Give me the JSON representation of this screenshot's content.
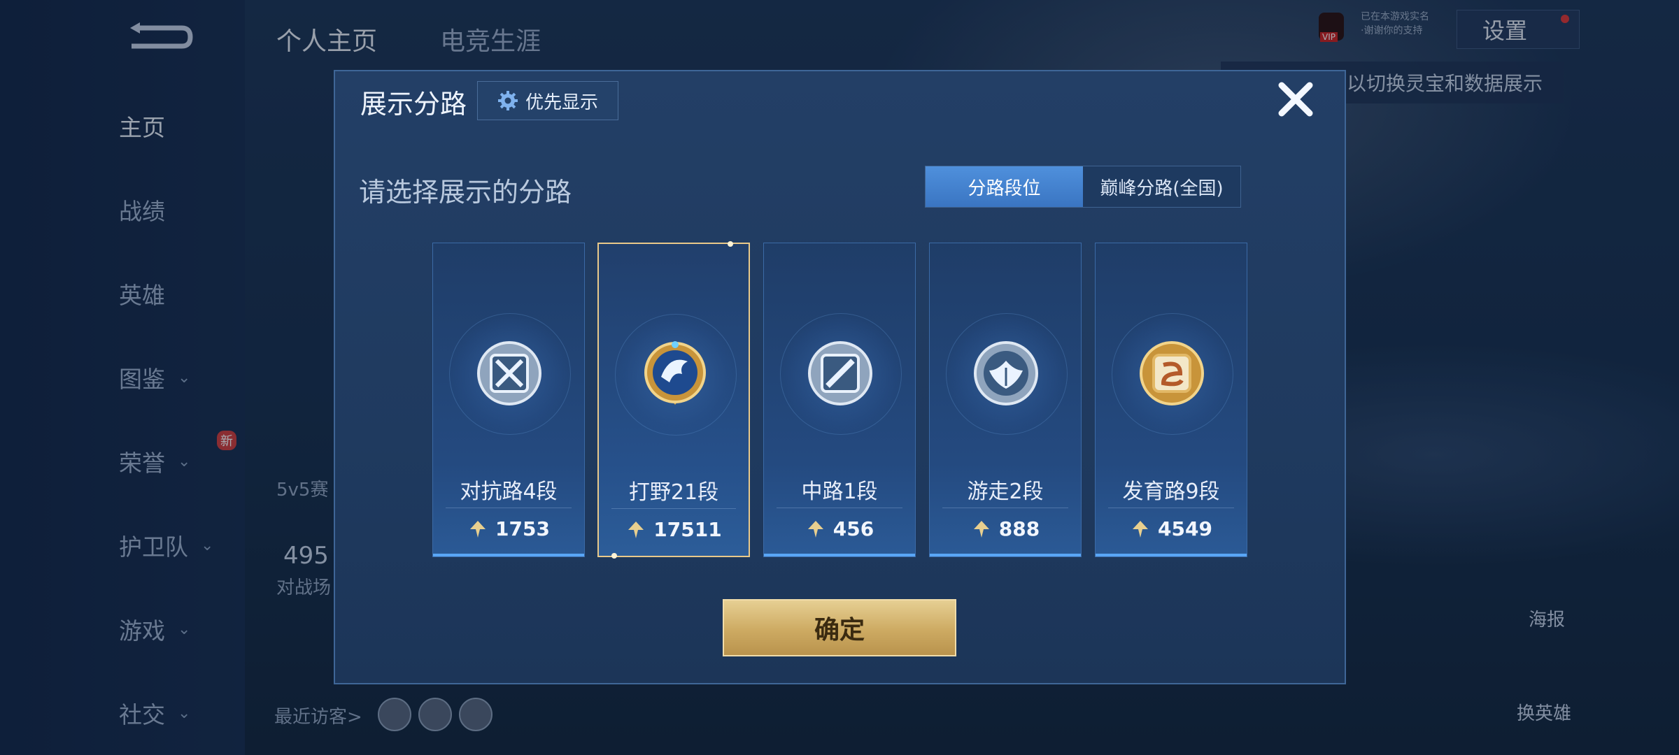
{
  "sidebar": {
    "items": [
      {
        "label": "主页",
        "has_chevron": false
      },
      {
        "label": "战绩",
        "has_chevron": false
      },
      {
        "label": "英雄",
        "has_chevron": false
      },
      {
        "label": "图鉴",
        "has_chevron": true
      },
      {
        "label": "荣誉",
        "has_chevron": true,
        "badge": "新"
      },
      {
        "label": "护卫队",
        "has_chevron": true
      },
      {
        "label": "游戏",
        "has_chevron": true
      },
      {
        "label": "社交",
        "has_chevron": true
      }
    ]
  },
  "header": {
    "tabs": [
      "个人主页",
      "电竞生涯"
    ],
    "settings_label": "设置",
    "vip_label": "VIP",
    "vip_lines": [
      "已在本游戏实名",
      "·谢谢你的支持"
    ]
  },
  "background": {
    "tip_text": "以切换灵宝和数据展示",
    "poster_label": "海报",
    "change_hero_label": "换英雄",
    "recent_visitors_label": "最近访客>",
    "frag_5v5": "5v5赛",
    "frag_num": "495",
    "frag_battle": "对战场"
  },
  "modal": {
    "title": "展示分路",
    "priority_label": "优先显示",
    "subtitle": "请选择展示的分路",
    "segment": {
      "options": [
        "分路段位",
        "巅峰分路(全国)"
      ],
      "selected_index": 0
    },
    "lanes": [
      {
        "label": "对抗路4段",
        "score": "1753",
        "icon": "sword-shield-icon",
        "selected": false
      },
      {
        "label": "打野21段",
        "score": "17511",
        "icon": "dragon-badge-icon",
        "selected": true
      },
      {
        "label": "中路1段",
        "score": "456",
        "icon": "mid-lane-icon",
        "selected": false
      },
      {
        "label": "游走2段",
        "score": "888",
        "icon": "wings-icon",
        "selected": false
      },
      {
        "label": "发育路9段",
        "score": "4549",
        "icon": "marksman-icon",
        "selected": false
      }
    ],
    "confirm_label": "确定"
  },
  "colors": {
    "accent_blue": "#4f90dc",
    "gold": "#cdaa62",
    "selected_border": "#e9c98a"
  }
}
